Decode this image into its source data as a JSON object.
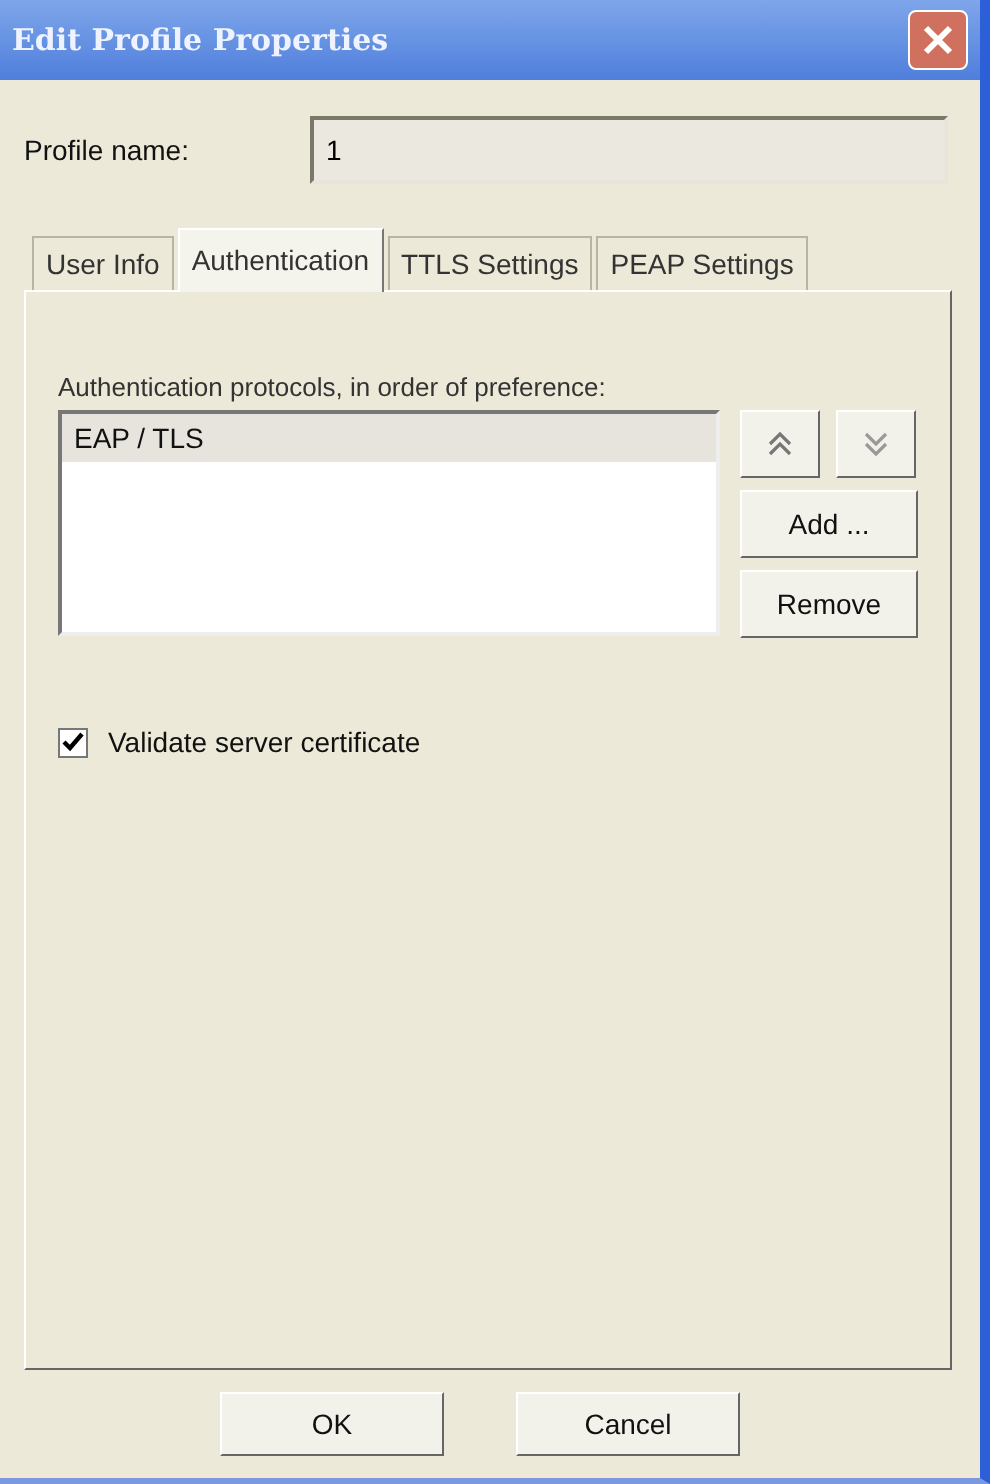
{
  "window": {
    "title": "Edit Profile Properties"
  },
  "profile_name": {
    "label": "Profile name:",
    "value": "1"
  },
  "tabs": [
    {
      "label": "User Info",
      "selected": false
    },
    {
      "label": "Authentication",
      "selected": true
    },
    {
      "label": "TTLS Settings",
      "selected": false
    },
    {
      "label": "PEAP Settings",
      "selected": false
    }
  ],
  "protocols": {
    "label": "Authentication protocols, in order of preference:",
    "items": [
      {
        "label": "EAP / TLS",
        "selected": true
      }
    ],
    "buttons": [
      "Add ...",
      "Remove"
    ]
  },
  "validate": {
    "label": "Validate server certificate",
    "checked": true
  },
  "buttons": [
    "OK",
    "Cancel"
  ]
}
